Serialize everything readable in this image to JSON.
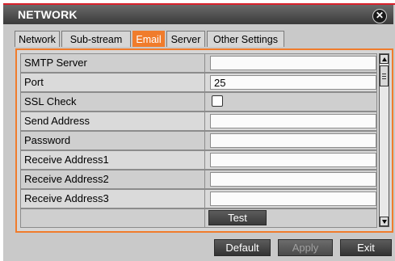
{
  "window": {
    "title": "NETWORK",
    "close_glyph": "✕"
  },
  "tabs": [
    {
      "label": "Network",
      "active": false
    },
    {
      "label": "Sub-stream",
      "active": false
    },
    {
      "label": "Email",
      "active": true
    },
    {
      "label": "Server",
      "active": false
    },
    {
      "label": "Other Settings",
      "active": false
    }
  ],
  "form": {
    "rows": [
      {
        "label": "SMTP Server",
        "type": "text",
        "value": ""
      },
      {
        "label": "Port",
        "type": "text",
        "value": "25"
      },
      {
        "label": "SSL Check",
        "type": "checkbox",
        "checked": false
      },
      {
        "label": "Send Address",
        "type": "text",
        "value": ""
      },
      {
        "label": "Password",
        "type": "text",
        "value": ""
      },
      {
        "label": "Receive Address1",
        "type": "text",
        "value": ""
      },
      {
        "label": "Receive Address2",
        "type": "text",
        "value": ""
      },
      {
        "label": "Receive Address3",
        "type": "text",
        "value": ""
      },
      {
        "label": "",
        "type": "button",
        "button_label": "Test"
      }
    ]
  },
  "footer": {
    "default_label": "Default",
    "apply_label": "Apply",
    "exit_label": "Exit"
  },
  "colors": {
    "accent": "#f07c2c",
    "title_bar": "#4a4a4a",
    "window_bg": "#c9c9c9"
  },
  "icons": {
    "close": "close-icon",
    "scroll_up": "scroll-up-arrow-icon",
    "scroll_down": "scroll-down-arrow-icon"
  }
}
